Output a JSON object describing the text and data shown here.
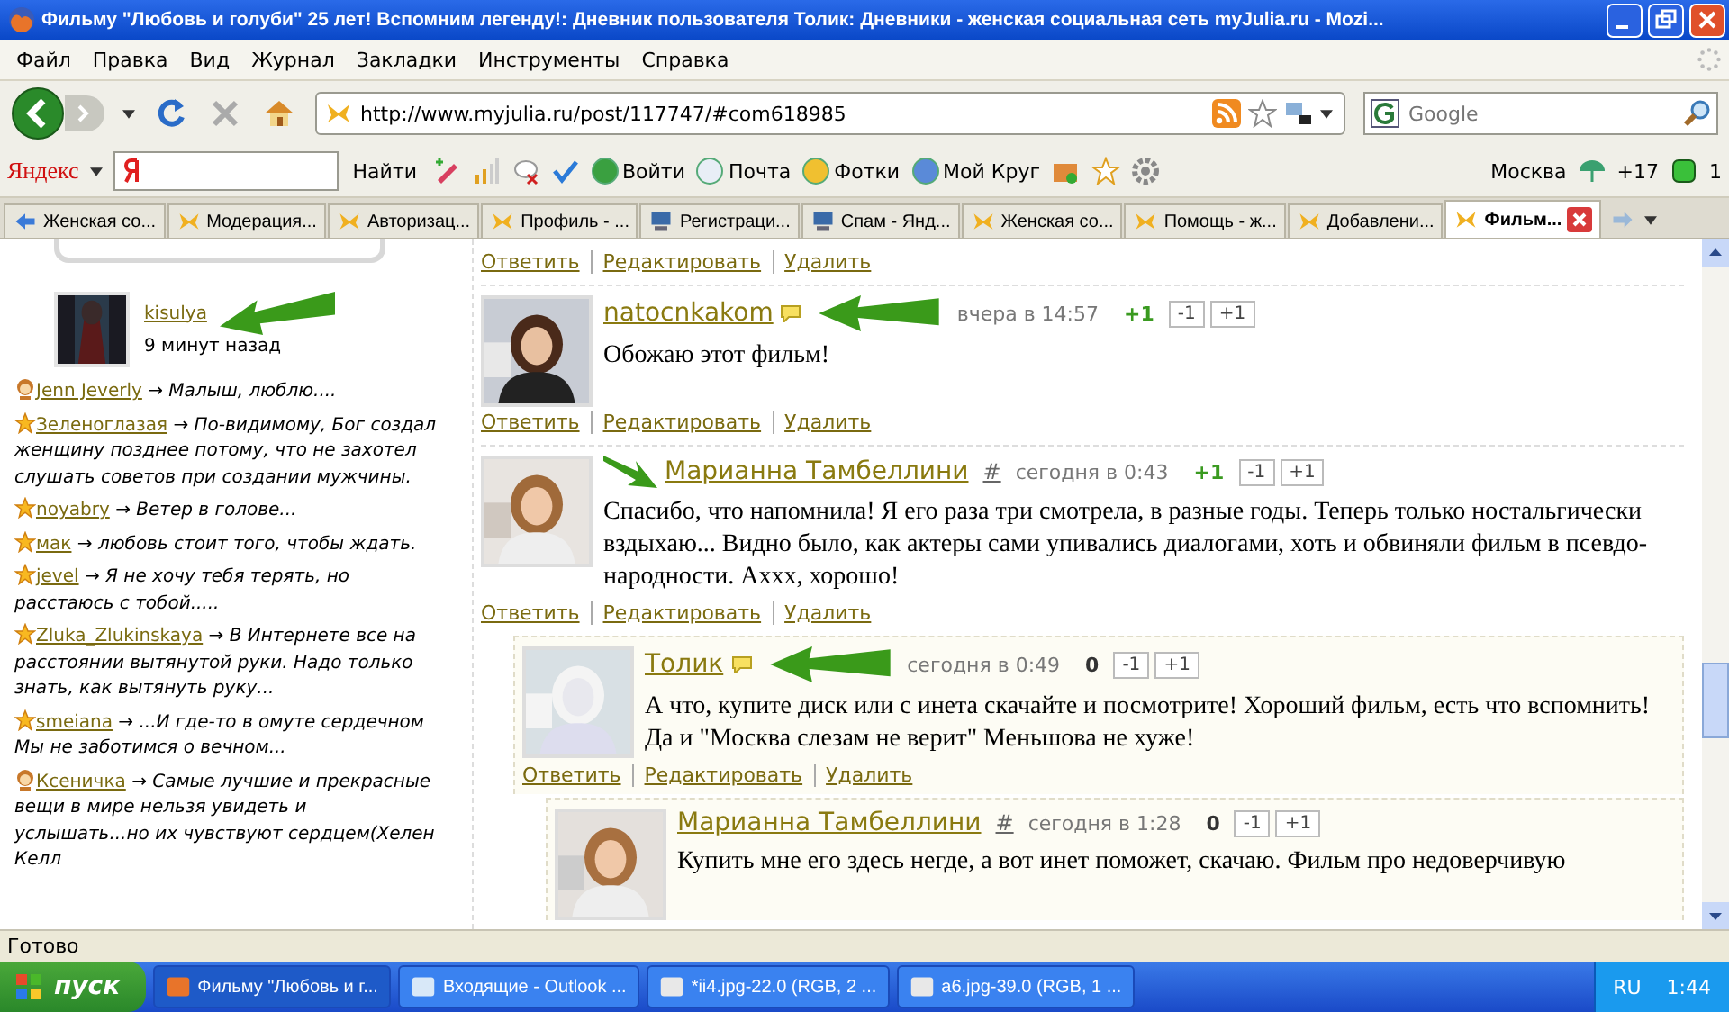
{
  "window": {
    "title": "Фильму \"Любовь и голуби\" 25 лет! Вспомним легенду!: Дневник пользователя Толик: Дневники - женская социальная сеть myJulia.ru - Mozi..."
  },
  "menu": [
    "Файл",
    "Правка",
    "Вид",
    "Журнал",
    "Закладки",
    "Инструменты",
    "Справка"
  ],
  "address_bar": {
    "value": "http://www.myjulia.ru/post/117747/#com618985"
  },
  "search": {
    "placeholder": "Google"
  },
  "yandex_bar": {
    "logo": "Яндекс",
    "search_button": "Найти",
    "items": [
      "Войти",
      "Почта",
      "Фотки",
      "Мой Круг"
    ],
    "city": "Москва",
    "temperature": "+17",
    "count": "1"
  },
  "tabs": [
    {
      "label": "Женская со...",
      "selected": false
    },
    {
      "label": "Модерация...",
      "selected": false
    },
    {
      "label": "Авторизац...",
      "selected": false
    },
    {
      "label": "Профиль - ...",
      "selected": false
    },
    {
      "label": "Регистраци...",
      "selected": false
    },
    {
      "label": "Спам - Янд...",
      "selected": false
    },
    {
      "label": "Женская со...",
      "selected": false
    },
    {
      "label": "Помощь - ж...",
      "selected": false
    },
    {
      "label": "Добавлени...",
      "selected": false
    },
    {
      "label": "Фильм...",
      "selected": true
    }
  ],
  "sidebar": {
    "user": {
      "name": "kisulya",
      "time": "9 минут назад"
    },
    "statuses": [
      {
        "kind": "girl",
        "name": "Jenn Jeverly",
        "text": "→ Малыш, люблю...."
      },
      {
        "kind": "star",
        "name": "Зеленоглазая",
        "text": "→ По-видимому, Бог создал женщину позднее потому, что не захотел слушать советов при создании мужчины."
      },
      {
        "kind": "star",
        "name": "noyabry",
        "text": "→ Ветер в голове..."
      },
      {
        "kind": "star",
        "name": "мак",
        "text": "→ любовь стоит того, чтобы ждать."
      },
      {
        "kind": "star",
        "name": "jevel",
        "text": "→ Я не хочу тебя терять, но расстаюсь с тобой....."
      },
      {
        "kind": "star",
        "name": "Zluka_Zlukinskaya",
        "text": "→ В Интернете все на расстоянии вытянутой руки. Надо только знать, как вытянуть руку..."
      },
      {
        "kind": "star",
        "name": "smeiana",
        "text": "→ ...И где-то в омуте сердечном Мы не заботимся о вечном..."
      },
      {
        "kind": "girl",
        "name": "Ксеничка",
        "text": "→ Самые лучшие и прекрасные вещи в мире нельзя увидеть и услышать...но их чувствуют сердцем(Хелен Келл"
      }
    ]
  },
  "top_actions": [
    "Ответить",
    "Редактировать",
    "Удалить"
  ],
  "comments": [
    {
      "author": "natocnkakom",
      "online": true,
      "time": "вчера в 14:57",
      "score": "+1",
      "positive": true,
      "votes": [
        "-1",
        "+1"
      ],
      "text": "Обожаю этот фильм!",
      "actions": [
        "Ответить",
        "Редактировать",
        "Удалить"
      ]
    },
    {
      "author": "Марианна Тамбеллини",
      "online": false,
      "hash": "#",
      "time": "сегодня в 0:43",
      "score": "+1",
      "positive": true,
      "votes": [
        "-1",
        "+1"
      ],
      "text": "Спасибо, что напомнила! Я его раза три смотрела, в разные годы. Теперь только ностальгически вздыхаю... Видно было, как актеры сами упивались диалогами, хоть и обвиняли фильм в псевдо-народности. Аххх, хорошо!",
      "actions": [
        "Ответить",
        "Редактировать",
        "Удалить"
      ],
      "children": [
        {
          "author": "Толик",
          "online": true,
          "time": "сегодня в 0:49",
          "score": "0",
          "positive": false,
          "votes": [
            "-1",
            "+1"
          ],
          "text": "А что, купите диск или с инета скачайте и посмотрите! Хороший фильм, есть что вспомнить! Да и \"Москва слезам не верит\" Меньшова не хуже!",
          "actions": [
            "Ответить",
            "Редактировать",
            "Удалить"
          ],
          "children": [
            {
              "author": "Марианна Тамбеллини",
              "online": false,
              "hash": "#",
              "time": "сегодня в 1:28",
              "score": "0",
              "positive": false,
              "votes": [
                "-1",
                "+1"
              ],
              "text": "Купить мне его здесь негде, а вот инет поможет, скачаю. Фильм про недоверчивую"
            }
          ]
        }
      ]
    }
  ],
  "status_bar": "Готово",
  "taskbar": {
    "start": "пуск",
    "items": [
      "Фильму \"Любовь и г...",
      "Входящие - Outlook ...",
      "*ii4.jpg-22.0 (RGB, 2 ...",
      "а6.jpg-39.0 (RGB, 1 ..."
    ],
    "lang": "RU",
    "clock": "1:44"
  }
}
